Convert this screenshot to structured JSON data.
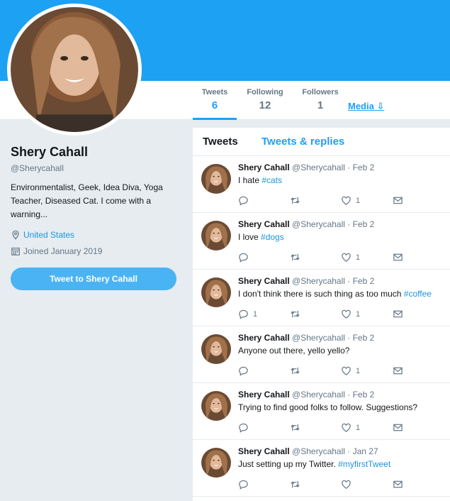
{
  "profile": {
    "name": "Shery Cahall",
    "handle": "@Sherycahall",
    "bio": "Environmentalist, Geek, Idea Diva, Yoga Teacher, Diseased Cat. I come with a warning...",
    "location": "United States",
    "joined": "Joined January 2019",
    "tweet_to_label": "Tweet to Shery Cahall"
  },
  "nav": {
    "tweets_label": "Tweets",
    "tweets_count": "6",
    "following_label": "Following",
    "following_count": "12",
    "followers_label": "Followers",
    "followers_count": "1",
    "media_label": "Media ⇩"
  },
  "tabs": {
    "tweets": "Tweets",
    "replies": "Tweets & replies"
  },
  "tweets": [
    {
      "name": "Shery Cahall",
      "meta": "@Sherycahall · Feb 2",
      "text": "I hate ",
      "tag": "#cats",
      "reply_count": "",
      "like_count": "1"
    },
    {
      "name": "Shery Cahall",
      "meta": "@Sherycahall · Feb 2",
      "text": "I love ",
      "tag": "#dogs",
      "reply_count": "",
      "like_count": "1"
    },
    {
      "name": "Shery Cahall",
      "meta": "@Sherycahall · Feb 2",
      "text": "I don't think there is such thing as too much ",
      "tag": "#coffee",
      "reply_count": "1",
      "like_count": "1"
    },
    {
      "name": "Shery Cahall",
      "meta": "@Sherycahall · Feb 2",
      "text": "Anyone out there, yello yello?",
      "tag": "",
      "reply_count": "",
      "like_count": "1"
    },
    {
      "name": "Shery Cahall",
      "meta": "@Sherycahall · Feb 2",
      "text": "Trying to find good folks to follow. Suggestions?",
      "tag": "",
      "reply_count": "",
      "like_count": "1"
    },
    {
      "name": "Shery Cahall",
      "meta": "@Sherycahall · Jan 27",
      "text": "Just setting up my Twitter. ",
      "tag": "#myfirstTweet",
      "reply_count": "",
      "like_count": ""
    }
  ],
  "colors": {
    "brand": "#1da1f2",
    "button": "#4ab3f4",
    "link": "#1b95e0",
    "muted": "#657786"
  },
  "icons": [
    "location-pin-icon",
    "calendar-icon",
    "reply-icon",
    "retweet-icon",
    "like-icon",
    "message-icon"
  ]
}
